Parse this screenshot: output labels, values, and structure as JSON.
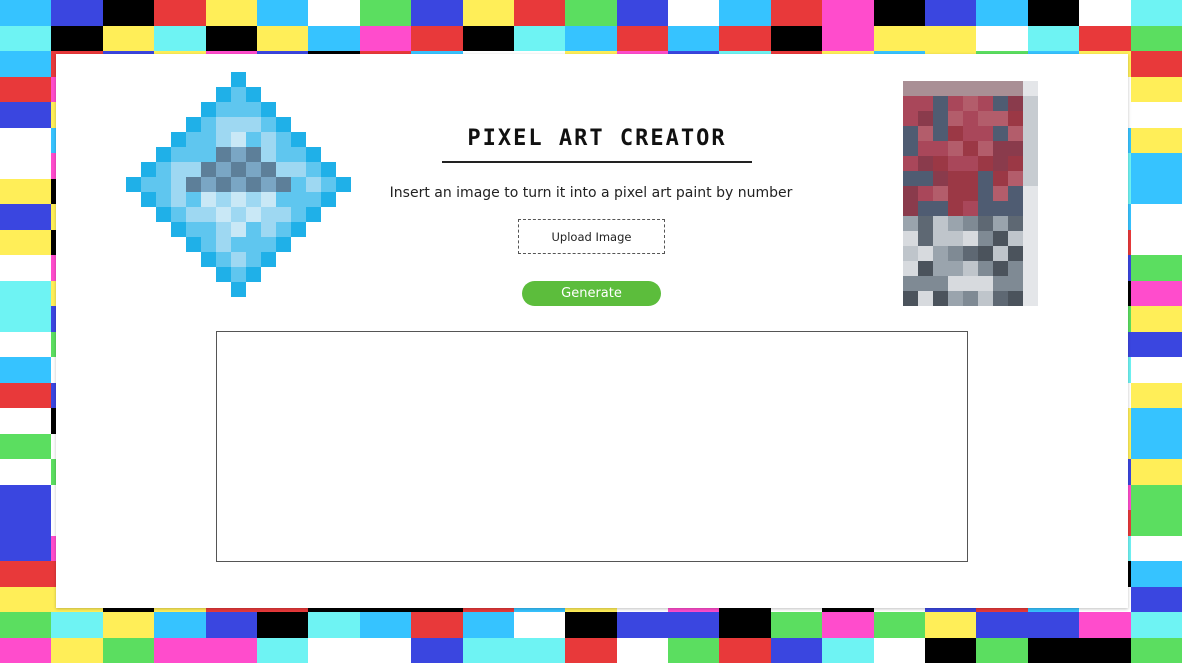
{
  "app": {
    "title": "PIXEL ART CREATOR",
    "subtitle": "Insert an image to turn it into a pixel art paint by number"
  },
  "actions": {
    "upload_label": "Upload Image",
    "generate_label": "Generate"
  },
  "colors": {
    "generate_green": "#5cbd3c",
    "card_bg": "#ffffff",
    "mosaic_palette": [
      "#ffffff",
      "#000000",
      "#e8393a",
      "#ffee58",
      "#36c3ff",
      "#3a46e0",
      "#ff4ccc",
      "#5bde60",
      "#6ef3f3"
    ]
  },
  "decor": {
    "left_icon": "pixel-diamond-icon",
    "right_icon": "pixel-portrait-icon"
  }
}
